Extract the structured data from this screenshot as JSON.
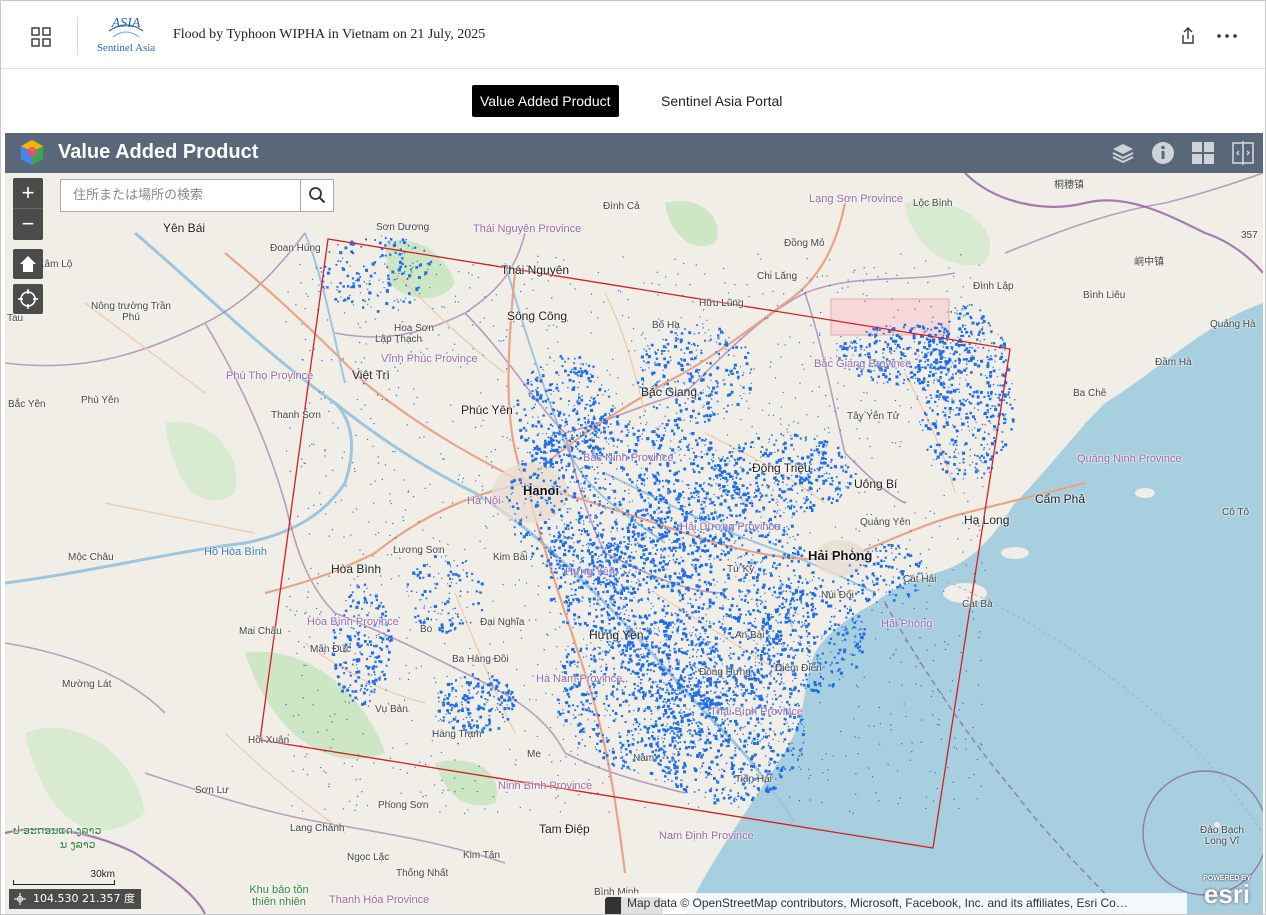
{
  "header": {
    "logo_text": "Sentinel Asia",
    "title": "Flood by Typhoon WIPHA in Vietnam on 21 July, 2025"
  },
  "tabs": [
    {
      "label": "Value Added Product",
      "active": true
    },
    {
      "label": "Sentinel Asia Portal",
      "active": false
    }
  ],
  "appbar": {
    "title": "Value Added Product",
    "background": "#5a6779"
  },
  "map": {
    "search_placeholder": "住所または場所の検索",
    "scale_label": "30km",
    "coordinates": "104.530 21.357 度",
    "attribution": "Map data © OpenStreetMap contributors, Microsoft, Facebook, Inc. and its affiliates, Esri Co…",
    "esri_powered": "POWERED BY",
    "esri_word": "esri",
    "flood_color": "#1e6fe6",
    "footprint_color": "#d42020",
    "places": [
      {
        "name": "Yên Bái",
        "kind": "city"
      },
      {
        "name": "Sơn Dương",
        "kind": "town"
      },
      {
        "name": "Đoan Hùng",
        "kind": "town"
      },
      {
        "name": "Lâm Lộ",
        "kind": "town"
      },
      {
        "name": "Nông trường Trần Phú",
        "kind": "town"
      },
      {
        "name": "Tau",
        "kind": "town"
      },
      {
        "name": "Hoa Sơn",
        "kind": "town"
      },
      {
        "name": "Lập Thạch",
        "kind": "town"
      },
      {
        "name": "Vĩnh Phúc Province",
        "kind": "prov"
      },
      {
        "name": "Phú Thọ Province",
        "kind": "prov"
      },
      {
        "name": "Việt Trì",
        "kind": "city"
      },
      {
        "name": "Bắc Yên",
        "kind": "town"
      },
      {
        "name": "Phù Yên",
        "kind": "town"
      },
      {
        "name": "Thanh Sơn",
        "kind": "town"
      },
      {
        "name": "Phúc Yên",
        "kind": "city"
      },
      {
        "name": "Thái Nguyên Province",
        "kind": "prov"
      },
      {
        "name": "Thái Nguyên",
        "kind": "city"
      },
      {
        "name": "Sông Công",
        "kind": "city"
      },
      {
        "name": "Đình Cả",
        "kind": "town"
      },
      {
        "name": "Đồng Mỏ",
        "kind": "town"
      },
      {
        "name": "Chi Lăng",
        "kind": "town"
      },
      {
        "name": "Hữu Lũng",
        "kind": "town"
      },
      {
        "name": "Bố Hạ",
        "kind": "town"
      },
      {
        "name": "Lạng Sơn Province",
        "kind": "prov"
      },
      {
        "name": "Lộc Bình",
        "kind": "town"
      },
      {
        "name": "桐穗镇",
        "kind": "town"
      },
      {
        "name": "357",
        "kind": "town"
      },
      {
        "name": "峒中镇",
        "kind": "town"
      },
      {
        "name": "Đình Lập",
        "kind": "town"
      },
      {
        "name": "Bình Liêu",
        "kind": "town"
      },
      {
        "name": "Quảng Hà",
        "kind": "town"
      },
      {
        "name": "Đầm Hà",
        "kind": "town"
      },
      {
        "name": "Ba Chẽ",
        "kind": "town"
      },
      {
        "name": "Bắc Giang Province",
        "kind": "prov"
      },
      {
        "name": "Bắc Giang",
        "kind": "city"
      },
      {
        "name": "Tây Yên Tử",
        "kind": "town"
      },
      {
        "name": "Quảng Ninh Province",
        "kind": "prov"
      },
      {
        "name": "Bắc Ninh Province",
        "kind": "prov"
      },
      {
        "name": "Hanoi",
        "kind": "big"
      },
      {
        "name": "Hà Nội",
        "kind": "prov"
      },
      {
        "name": "Đông Triều",
        "kind": "city"
      },
      {
        "name": "Uông Bí",
        "kind": "city"
      },
      {
        "name": "Cẩm Phả",
        "kind": "city"
      },
      {
        "name": "Cô Tô",
        "kind": "town"
      },
      {
        "name": "Hạ Long",
        "kind": "city"
      },
      {
        "name": "Quảng Yên",
        "kind": "town"
      },
      {
        "name": "Hải Dương Province",
        "kind": "prov"
      },
      {
        "name": "Hải Phòng",
        "kind": "big"
      },
      {
        "name": "Cát Hải",
        "kind": "town"
      },
      {
        "name": "Cát Bà",
        "kind": "town"
      },
      {
        "name": "Núi Đối",
        "kind": "town"
      },
      {
        "name": "Hải Phòng",
        "kind": "prov"
      },
      {
        "name": "Mộc Châu",
        "kind": "town"
      },
      {
        "name": "Hồ Hòa Bình",
        "kind": "water"
      },
      {
        "name": "Lương Sơn",
        "kind": "town"
      },
      {
        "name": "Kim Bài",
        "kind": "town"
      },
      {
        "name": "Hưng Yên",
        "kind": "prov"
      },
      {
        "name": "Tứ Kỳ",
        "kind": "town"
      },
      {
        "name": "Hòa Bình",
        "kind": "city"
      },
      {
        "name": "Hòa Bình Province",
        "kind": "prov"
      },
      {
        "name": "Mai Châu",
        "kind": "town"
      },
      {
        "name": "Bo",
        "kind": "town"
      },
      {
        "name": "Đại Nghĩa",
        "kind": "town"
      },
      {
        "name": "Hưng Yên",
        "kind": "city"
      },
      {
        "name": "An Bài",
        "kind": "town"
      },
      {
        "name": "Mãn Đức",
        "kind": "town"
      },
      {
        "name": "Ba Hàng Đồi",
        "kind": "town"
      },
      {
        "name": "Hà Nam Province",
        "kind": "prov"
      },
      {
        "name": "Đông Hưng",
        "kind": "town"
      },
      {
        "name": "Diêm Điền",
        "kind": "town"
      },
      {
        "name": "Mường Lát",
        "kind": "town"
      },
      {
        "name": "Vụ Bản",
        "kind": "town"
      },
      {
        "name": "Thái Bình Province",
        "kind": "prov"
      },
      {
        "name": "Hồi Xuân",
        "kind": "town"
      },
      {
        "name": "Hàng Trạm",
        "kind": "town"
      },
      {
        "name": "Me",
        "kind": "town"
      },
      {
        "name": "Nam",
        "kind": "town"
      },
      {
        "name": "Tiền Hải",
        "kind": "town"
      },
      {
        "name": "Ninh Bình Province",
        "kind": "prov"
      },
      {
        "name": "Sơn Lư",
        "kind": "town"
      },
      {
        "name": "Phong Sơn",
        "kind": "town"
      },
      {
        "name": "Tam Điệp",
        "kind": "city"
      },
      {
        "name": "Nam Định Province",
        "kind": "prov"
      },
      {
        "name": "ປ ອະດອນແດ ງລາວ",
        "kind": "park"
      },
      {
        "name": "ນ ງລາວ",
        "kind": "park"
      },
      {
        "name": "Lang Chánh",
        "kind": "town"
      },
      {
        "name": "Ngọc Lặc",
        "kind": "town"
      },
      {
        "name": "Kim Tân",
        "kind": "town"
      },
      {
        "name": "Thống Nhất",
        "kind": "town"
      },
      {
        "name": "Khu bảo tồn thiên nhiên",
        "kind": "park"
      },
      {
        "name": "Thanh Hóa Province",
        "kind": "prov"
      },
      {
        "name": "Bình Minh",
        "kind": "town"
      },
      {
        "name": "Đảo Bạch Long Vĩ",
        "kind": "town"
      }
    ]
  }
}
